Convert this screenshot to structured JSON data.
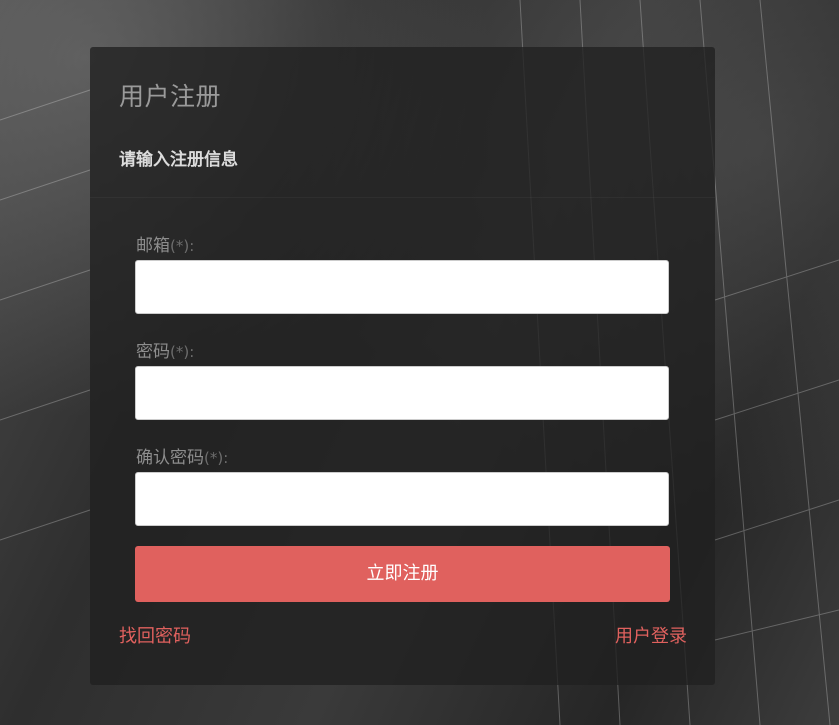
{
  "panel": {
    "title": "用户注册",
    "subtitle": "请输入注册信息"
  },
  "fields": [
    {
      "label": "邮箱",
      "required_mark": "(*):",
      "value": ""
    },
    {
      "label": "密码",
      "required_mark": "(*):",
      "value": ""
    },
    {
      "label": "确认密码",
      "required_mark": "(*):",
      "value": ""
    }
  ],
  "register_button": {
    "label": "立即注册"
  },
  "links": {
    "forgot_password": "找回密码",
    "user_login": "用户登录"
  },
  "colors": {
    "accent": "#e0615e",
    "panel_bg": "#202020"
  }
}
